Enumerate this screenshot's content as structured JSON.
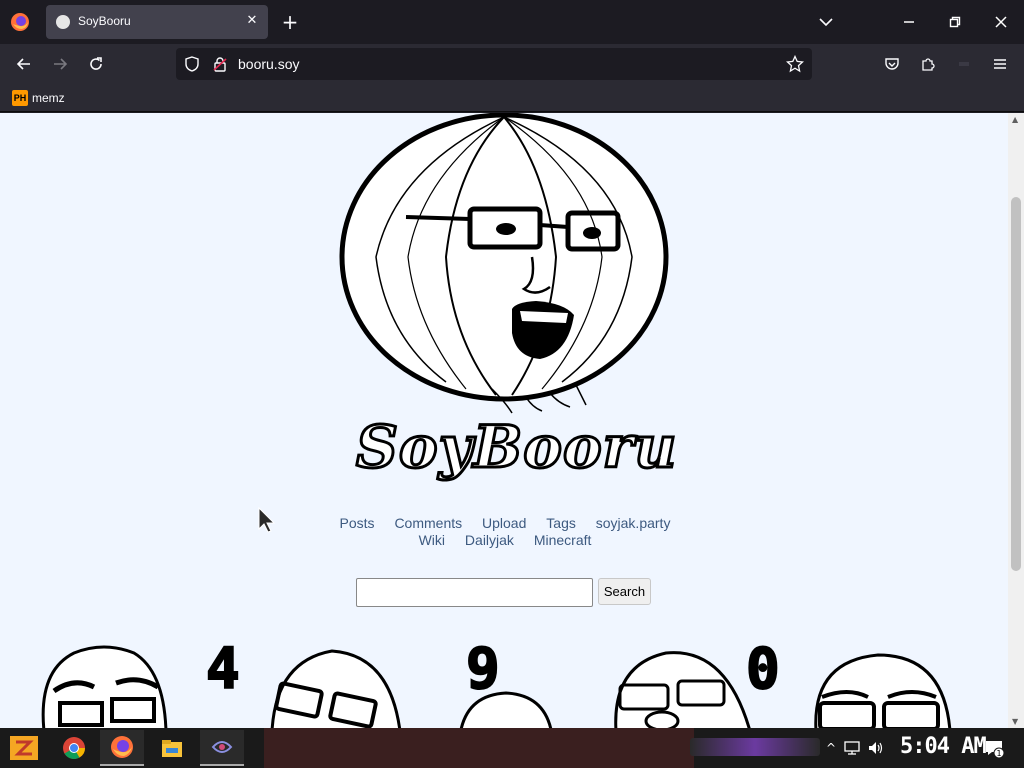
{
  "browser": {
    "tab_title": "SoyBooru",
    "url": "booru.soy",
    "bookmark": {
      "label": "memz",
      "icon_text": "PH"
    }
  },
  "page": {
    "logo_text": "SoyBooru",
    "nav_row1": [
      "Posts",
      "Comments",
      "Upload",
      "Tags",
      "soyjak.party"
    ],
    "nav_row2": [
      "Wiki",
      "Dailyjak",
      "Minecraft"
    ],
    "search": {
      "value": "",
      "button_label": "Search"
    },
    "counter_digits": [
      "4",
      "9",
      "0"
    ]
  },
  "taskbar": {
    "apps": [
      "chrome-icon",
      "firefox-icon",
      "file-explorer-icon",
      "unknown-app-icon"
    ],
    "clock": "5:04 AM",
    "notification_count": "1"
  },
  "colors": {
    "page_bg": "#f0f6ff",
    "link": "#3d5a80",
    "browser_chrome": "#2b2a33",
    "tabstrip": "#1c1b22"
  }
}
